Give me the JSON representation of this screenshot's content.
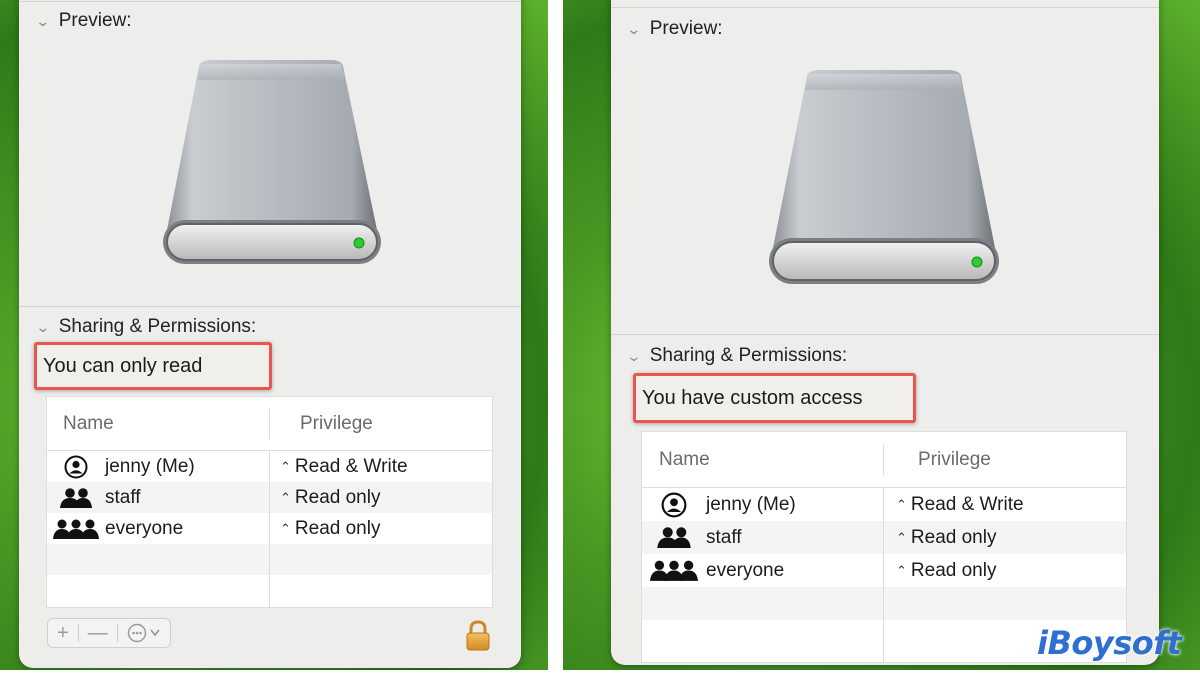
{
  "left": {
    "preview_header": "Preview:",
    "sharing_header": "Sharing & Permissions:",
    "status": "You can only read",
    "columns": {
      "name": "Name",
      "privilege": "Privilege"
    },
    "rows": [
      {
        "icon": "user-icon",
        "name": "jenny (Me)",
        "privilege": "Read & Write"
      },
      {
        "icon": "group-icon",
        "name": "staff",
        "privilege": "Read only"
      },
      {
        "icon": "everyone-icon",
        "name": "everyone",
        "privilege": "Read only"
      }
    ],
    "toolbar": {
      "add": "+",
      "remove": "—",
      "action": "⋯"
    }
  },
  "right": {
    "preview_header": "Preview:",
    "sharing_header": "Sharing & Permissions:",
    "status": "You have custom access",
    "columns": {
      "name": "Name",
      "privilege": "Privilege"
    },
    "rows": [
      {
        "icon": "user-icon",
        "name": "jenny (Me)",
        "privilege": "Read & Write"
      },
      {
        "icon": "group-icon",
        "name": "staff",
        "privilege": "Read only"
      },
      {
        "icon": "everyone-icon",
        "name": "everyone",
        "privilege": "Read only"
      }
    ]
  },
  "watermark": "iBoysoft",
  "colors": {
    "highlight": "#e8564f",
    "background_green": "#4a9a24",
    "drive_led": "#2ecc2e",
    "lock": "#e0a43a"
  }
}
